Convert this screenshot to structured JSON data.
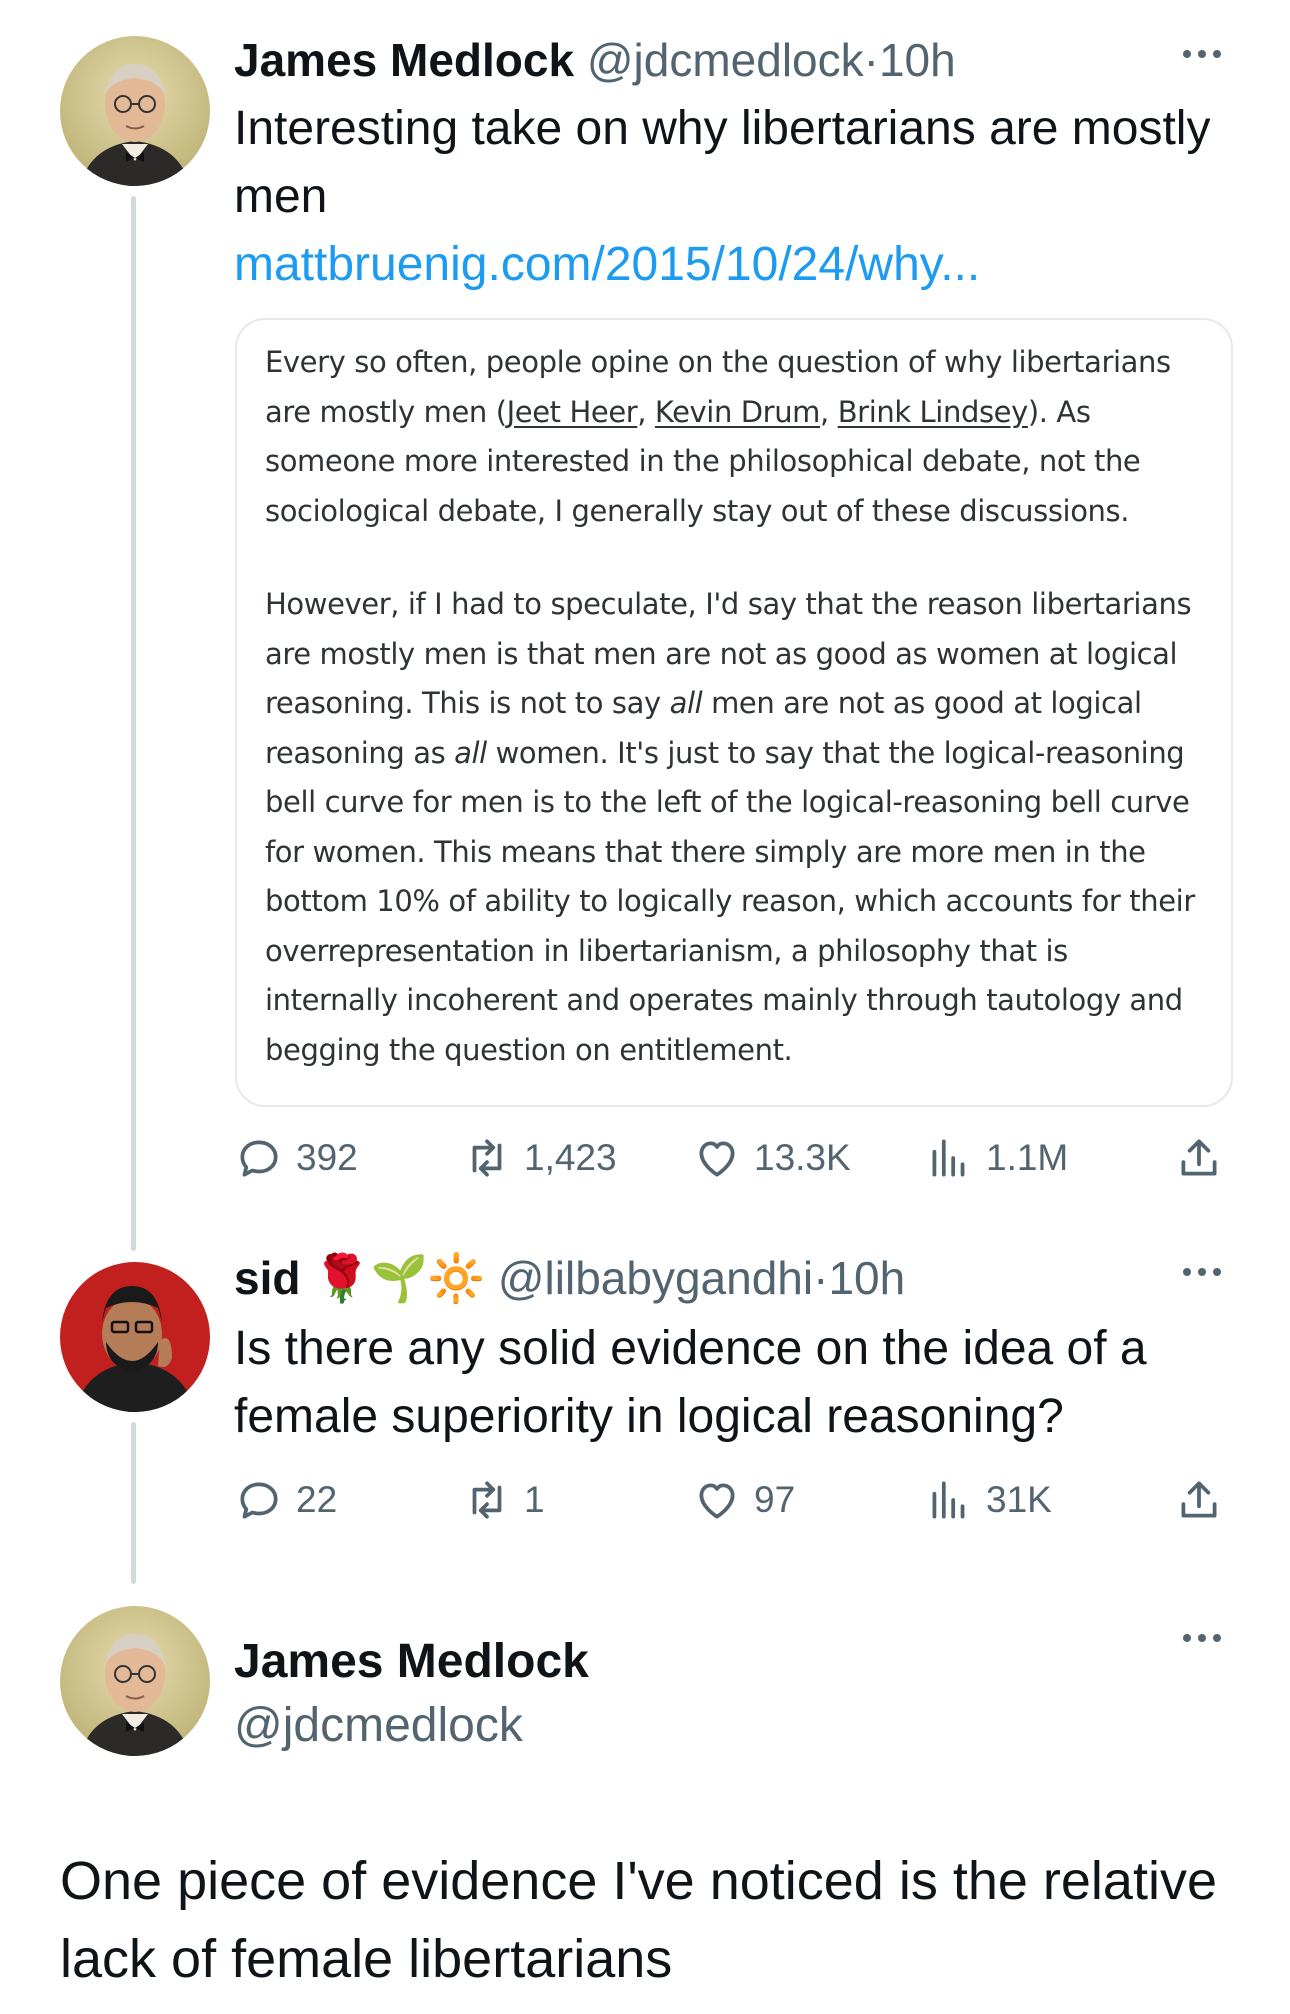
{
  "thread": {
    "tweet1": {
      "display_name": "James Medlock",
      "handle": "@jdcmedlock",
      "separator": "·",
      "time": "10h",
      "text": "Interesting take on why libertarians are mostly men",
      "link": "mattbruenig.com/2015/10/24/why...",
      "card": {
        "p1_before": "Every so often, people opine on the question of why libertarians are mostly men (",
        "p1_link1": "Jeet Heer",
        "p1_sep1": ", ",
        "p1_link2": "Kevin Drum",
        "p1_sep2": ", ",
        "p1_link3": "Brink Lindsey",
        "p1_after": "). As someone more interested in the philosophical debate, not the sociological debate, I generally stay out of these discussions.",
        "p2_a": "However, if I had to speculate, I'd say that the reason libertarians are mostly men is that men are not as good as women at logical reasoning. This is not to say ",
        "p2_em1": "all",
        "p2_b": " men are not as good at logical reasoning as ",
        "p2_em2": "all",
        "p2_c": " women. It's just to say that the logical-reasoning bell curve for men is to the left of the logical-reasoning bell curve for women. This means that there simply are more men in the bottom 10% of ability to logically reason, which accounts for their overrepresentation in libertarianism, a philosophy that is internally incoherent and operates mainly through tautology and begging the question on entitlement."
      },
      "stats": {
        "replies": "392",
        "reposts": "1,423",
        "likes": "13.3K",
        "views": "1.1M"
      }
    },
    "tweet2": {
      "display_name": "sid",
      "emojis": "🌹🌱🔆",
      "handle": "@lilbabygandhi",
      "separator": "·",
      "time": "10h",
      "text": "Is there any solid evidence on the idea of a female superiority in logical reasoning?",
      "stats": {
        "replies": "22",
        "reposts": "1",
        "likes": "97",
        "views": "31K"
      }
    },
    "tweet3": {
      "display_name": "James Medlock",
      "handle": "@jdcmedlock",
      "text": "One piece of evidence I've noticed is the relative lack of female libertarians"
    }
  },
  "icons": {
    "reply": "reply-icon",
    "repost": "repost-icon",
    "like": "like-icon",
    "views": "views-icon",
    "share": "share-icon",
    "more": "more-icon"
  },
  "colors": {
    "text": "#0f1419",
    "muted": "#536471",
    "link": "#1d9bf0",
    "border": "#e6e9eb",
    "thread_line": "#cfd9de"
  }
}
